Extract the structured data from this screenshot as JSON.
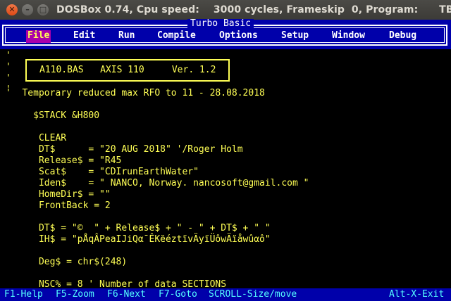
{
  "window": {
    "close_glyph": "✕",
    "min_glyph": "–",
    "max_glyph": "□",
    "title": "DOSBox 0.74, Cpu speed:    3000 cycles, Frameskip  0, Program:      TB"
  },
  "app": {
    "title": "Turbo Basic"
  },
  "menu": {
    "items": [
      "File",
      "Edit",
      "Run",
      "Compile",
      "Options",
      "Setup",
      "Window",
      "Debug"
    ],
    "active": "File"
  },
  "editor": {
    "lines": [
      "'",
      "'",
      "'",
      "'",
      "'  Temporary reduced max RFO to 11 - 28.08.2018",
      "",
      "     $STACK &H800",
      "",
      "      CLEAR",
      "      DT$      = \"20 AUG 2018\" '/Roger Holm",
      "      Release$ = \"R45",
      "      Scat$    = \"CDIrunEarthWater\"",
      "      Iden$    = \" NANCO, Norway. nancosoft@gmail.com \"",
      "      HomeDir$ = \"\"",
      "      FrontBack = 2",
      "",
      "      DT$ = \"©  \" + Release$ + \" - \" + DT$ + \" \"",
      "      IH$ = \"pÅqÂPeaIJiQα¯ÊKëéztïvÄyïÜôwÄïåwûαô\"",
      "",
      "      Deg$ = chr$(248)",
      "",
      "      NSC% = 8 ' Number of data SECTIONS"
    ],
    "header_box": "A110.BAS   AXIS 110     Ver. 1.2"
  },
  "status": {
    "items": [
      "F1-Help",
      "F5-Zoom",
      "F6-Next",
      "F7-Goto",
      "SCROLL-Size/move"
    ],
    "exit": "Alt-X-Exit"
  },
  "colors": {
    "menu_bg": "#0000aa",
    "editor_text": "#ffff55",
    "active_menu_bg": "#aa00aa",
    "status_text": "#55ffff"
  }
}
